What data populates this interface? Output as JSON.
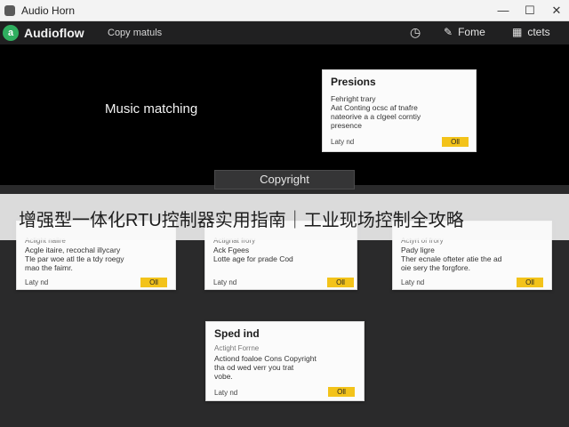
{
  "window": {
    "title": "Audio Horn",
    "controls": [
      "—",
      "☐",
      "✕"
    ]
  },
  "app": {
    "name": "Audioflow",
    "logo": "a",
    "subtitle": "Copy matuls",
    "clock_icon": "clock-icon",
    "actions": [
      {
        "icon": "edit-icon",
        "glyph": "✎",
        "label": "Fome"
      },
      {
        "icon": "grid-icon",
        "glyph": "▦",
        "label": "ctets"
      }
    ]
  },
  "main": {
    "heading": "Music matching",
    "copyright_button": "Copyright"
  },
  "cards": [
    {
      "title": "Presions",
      "sub": "",
      "body": [
        "Fehright trary",
        "Aat Conting ocsc af tnafre",
        "nateorive a a clgeel corntiy",
        "presence"
      ],
      "foot": "Laty nd",
      "ok": "Oll"
    },
    {
      "title": "",
      "sub": "Aclight naiire",
      "body": [
        "Acgle itaire, recochal illycary",
        "Tle par woe atl tle a tdy roegy",
        "mao the faimr."
      ],
      "foot": "Laty nd",
      "ok": "Oll"
    },
    {
      "title": "",
      "sub": "Actignat frory",
      "body": [
        "Ack Fgees",
        "Lotte age for prade Cod"
      ],
      "foot": "Laty nd",
      "ok": "Oll"
    },
    {
      "title": "",
      "sub": "Actyrt of frory",
      "body": [
        "Pady ligre",
        "Ther ecnale ofteter atie the ad",
        "oie sery the forgfore."
      ],
      "foot": "Laty nd",
      "ok": "Oll"
    },
    {
      "title": "Sped ind",
      "sub": "Actight Forrne",
      "body": [
        "Actiond foaloe Cons Copyright",
        "tha od wed verr you trat",
        "vobe."
      ],
      "foot": "Laty nd",
      "ok": "Oll"
    }
  ],
  "banner": {
    "text": "增强型一体化RTU控制器实用指南｜工业现场控制全攻略"
  }
}
